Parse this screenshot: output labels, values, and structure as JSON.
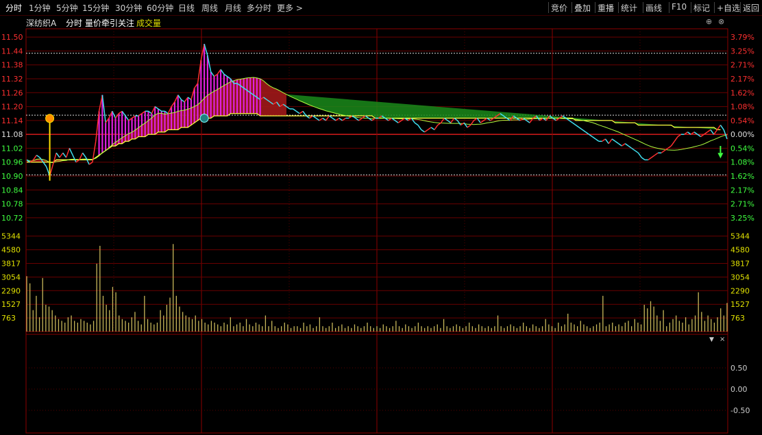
{
  "toolbar": {
    "periods": [
      "分时",
      "1分钟",
      "5分钟",
      "15分钟",
      "30分钟",
      "60分钟",
      "日线",
      "周线",
      "月线",
      "多分时",
      "更多 >"
    ],
    "right": [
      "竞价",
      "叠加",
      "重播",
      "统计",
      "画线",
      "F10",
      "标记",
      "+自选",
      "返回"
    ]
  },
  "header": {
    "stock_name": "深纺织A",
    "mode": "分时",
    "indicator": "量价牵引关注",
    "volume_label": "成交量"
  },
  "colors": {
    "up": "#ff3030",
    "down": "#40ff40",
    "price_line": "#40e0f0",
    "avg_line": "#ffff40",
    "volume": "#c8b85a",
    "grid": "#8b0000",
    "bar": "#e020e0",
    "band": "#a01818",
    "green_band": "#1a8a1a"
  },
  "chart_data": {
    "type": "line",
    "prev_close": 11.08,
    "price_axis": {
      "ticks": [
        "11.50",
        "11.44",
        "11.38",
        "11.32",
        "11.26",
        "11.20",
        "11.14",
        "11.08",
        "11.02",
        "10.96",
        "10.90",
        "10.84",
        "10.78",
        "10.72"
      ],
      "pct_ticks": [
        "3.79%",
        "3.25%",
        "2.71%",
        "2.17%",
        "1.62%",
        "1.08%",
        "0.54%",
        "0.00%",
        "0.54%",
        "1.08%",
        "1.62%",
        "2.17%",
        "2.71%",
        "3.25%"
      ],
      "ylim": [
        10.69,
        11.53
      ]
    },
    "volume_axis": {
      "ticks": [
        "5344",
        "4580",
        "3817",
        "3054",
        "2290",
        "1527",
        "763"
      ],
      "ylim": [
        0,
        5600
      ]
    },
    "indicator_axis": {
      "ticks": [
        "0.50",
        "0.00",
        "-0.50"
      ]
    },
    "price": [
      10.97,
      10.96,
      10.97,
      10.99,
      10.98,
      10.96,
      10.94,
      10.9,
      10.95,
      11.0,
      10.98,
      11.0,
      10.98,
      11.02,
      10.99,
      10.96,
      10.97,
      11.0,
      10.98,
      10.95,
      10.96,
      11.05,
      11.18,
      11.25,
      11.13,
      11.15,
      11.18,
      11.15,
      11.17,
      11.18,
      11.16,
      11.14,
      11.15,
      11.16,
      11.16,
      11.17,
      11.18,
      11.18,
      11.17,
      11.2,
      11.19,
      11.18,
      11.18,
      11.17,
      11.2,
      11.22,
      11.25,
      11.23,
      11.22,
      11.24,
      11.23,
      11.28,
      11.3,
      11.4,
      11.47,
      11.42,
      11.35,
      11.33,
      11.34,
      11.36,
      11.34,
      11.33,
      11.32,
      11.3,
      11.3,
      11.29,
      11.28,
      11.27,
      11.26,
      11.25,
      11.24,
      11.23,
      11.24,
      11.23,
      11.22,
      11.21,
      11.22,
      11.2,
      11.21,
      11.2,
      11.19,
      11.19,
      11.18,
      11.17,
      11.18,
      11.16,
      11.15,
      11.16,
      11.15,
      11.14,
      11.15,
      11.14,
      11.16,
      11.15,
      11.14,
      11.15,
      11.14,
      11.15,
      11.15,
      11.16,
      11.15,
      11.14,
      11.15,
      11.16,
      11.15,
      11.14,
      11.15,
      11.15,
      11.16,
      11.15,
      11.14,
      11.15,
      11.14,
      11.13,
      11.14,
      11.15,
      11.14,
      11.15,
      11.13,
      11.12,
      11.1,
      11.09,
      11.1,
      11.11,
      11.1,
      11.12,
      11.13,
      11.15,
      11.14,
      11.13,
      11.15,
      11.14,
      11.12,
      11.13,
      11.11,
      11.12,
      11.14,
      11.15,
      11.13,
      11.14,
      11.15,
      11.14,
      11.15,
      11.16,
      11.17,
      11.16,
      11.15,
      11.14,
      11.16,
      11.15,
      11.14,
      11.15,
      11.14,
      11.13,
      11.15,
      11.16,
      11.14,
      11.15,
      11.14,
      11.16,
      11.15,
      11.14,
      11.15,
      11.16,
      11.15,
      11.14,
      11.13,
      11.12,
      11.11,
      11.1,
      11.09,
      11.08,
      11.07,
      11.06,
      11.05,
      11.05,
      11.06,
      11.04,
      11.06,
      11.05,
      11.04,
      11.03,
      11.04,
      11.03,
      11.02,
      11.01,
      11.0,
      10.98,
      10.97,
      10.97,
      10.98,
      10.99,
      11.0,
      11.0,
      11.01,
      11.02,
      11.03,
      11.05,
      11.07,
      11.08,
      11.08,
      11.09,
      11.08,
      11.09,
      11.08,
      11.07,
      11.08,
      11.09,
      11.1,
      11.08,
      11.1,
      11.12,
      11.1,
      11.06
    ],
    "avg": [
      10.96,
      10.96,
      10.96,
      10.96,
      10.96,
      10.96,
      10.96,
      10.96,
      10.96,
      10.97,
      10.97,
      10.97,
      10.97,
      10.97,
      10.97,
      10.97,
      10.97,
      10.97,
      10.97,
      10.97,
      10.97,
      10.98,
      10.99,
      11.0,
      11.01,
      11.02,
      11.03,
      11.03,
      11.04,
      11.04,
      11.05,
      11.05,
      11.06,
      11.06,
      11.07,
      11.07,
      11.07,
      11.08,
      11.08,
      11.08,
      11.09,
      11.09,
      11.09,
      11.1,
      11.1,
      11.1,
      11.1,
      11.11,
      11.11,
      11.11,
      11.12,
      11.13,
      11.14,
      11.15,
      11.15,
      11.15,
      11.15,
      11.16,
      11.16,
      11.16,
      11.16,
      11.16,
      11.17,
      11.17,
      11.17,
      11.17,
      11.17,
      11.17,
      11.17,
      11.17,
      11.17,
      11.16,
      11.16,
      11.16,
      11.16,
      11.16,
      11.16,
      11.16,
      11.16,
      11.16,
      11.16,
      11.16,
      11.16,
      11.16,
      11.16,
      11.16,
      11.16,
      11.16,
      11.16,
      11.16,
      11.16,
      11.16,
      11.16,
      11.16,
      11.16,
      11.16,
      11.16,
      11.16,
      11.16,
      11.16,
      11.16,
      11.16,
      11.16,
      11.16,
      11.16,
      11.16,
      11.15,
      11.15,
      11.15,
      11.15,
      11.15,
      11.15,
      11.15,
      11.15,
      11.15,
      11.15,
      11.15,
      11.15,
      11.15,
      11.15,
      11.15,
      11.15,
      11.15,
      11.15,
      11.15,
      11.15,
      11.15,
      11.15,
      11.15,
      11.15,
      11.15,
      11.15,
      11.15,
      11.15,
      11.15,
      11.15,
      11.15,
      11.15,
      11.15,
      11.15,
      11.15,
      11.15,
      11.15,
      11.15,
      11.15,
      11.15,
      11.15,
      11.15,
      11.15,
      11.15,
      11.15,
      11.15,
      11.15,
      11.15,
      11.15,
      11.15,
      11.15,
      11.15,
      11.15,
      11.15,
      11.15,
      11.15,
      11.15,
      11.15,
      11.15,
      11.15,
      11.15,
      11.14,
      11.14,
      11.14,
      11.14,
      11.14,
      11.14,
      11.14,
      11.14,
      11.14,
      11.14,
      11.14,
      11.14,
      11.13,
      11.13,
      11.13,
      11.13,
      11.13,
      11.13,
      11.13,
      11.12,
      11.12,
      11.12,
      11.12,
      11.12,
      11.12,
      11.12,
      11.12,
      11.12,
      11.12,
      11.12,
      11.11,
      11.11,
      11.11,
      11.11,
      11.11,
      11.11,
      11.11,
      11.11,
      11.11,
      11.11,
      11.11,
      11.11,
      11.11,
      11.1,
      11.1
    ],
    "volume": [
      3100,
      2700,
      1200,
      2000,
      800,
      3000,
      1500,
      1400,
      1200,
      900,
      700,
      600,
      500,
      800,
      900,
      600,
      500,
      700,
      600,
      500,
      400,
      600,
      3800,
      4800,
      2000,
      1500,
      1200,
      2500,
      2200,
      900,
      700,
      600,
      500,
      800,
      1100,
      600,
      400,
      2000,
      700,
      500,
      400,
      500,
      1200,
      900,
      1500,
      1900,
      4900,
      2000,
      1400,
      1100,
      900,
      800,
      700,
      900,
      600,
      700,
      500,
      400,
      600,
      500,
      400,
      300,
      500,
      400,
      800,
      300,
      400,
      500,
      300,
      700,
      400,
      300,
      500,
      400,
      300,
      900,
      300,
      600,
      300,
      200,
      300,
      500,
      400,
      200,
      300,
      300,
      200,
      500,
      300,
      400,
      200,
      300,
      800,
      300,
      200,
      300,
      500,
      200,
      300,
      400,
      200,
      300,
      200,
      400,
      300,
      200,
      300,
      500,
      300,
      200,
      300,
      200,
      400,
      300,
      200,
      300,
      600,
      300,
      200,
      400,
      300,
      200,
      300,
      500,
      300,
      200,
      300,
      200,
      300,
      400,
      200,
      700,
      300,
      200,
      300,
      400,
      300,
      200,
      300,
      500,
      300,
      200,
      400,
      300,
      200,
      300,
      200,
      300,
      900,
      300,
      200,
      300,
      400,
      300,
      200,
      300,
      500,
      300,
      200,
      400,
      300,
      200,
      300,
      700,
      400,
      300,
      200,
      500,
      300,
      400,
      1000,
      500,
      400,
      300,
      600,
      400,
      300,
      200,
      300,
      400,
      500,
      2000,
      300,
      400,
      500,
      300,
      400,
      300,
      500,
      600,
      300,
      700,
      500,
      400,
      1500,
      1300,
      1700,
      1400,
      900,
      600,
      1200,
      300,
      500,
      700,
      900,
      600,
      500,
      800,
      400,
      700,
      900,
      2200,
      1100,
      600,
      900,
      700,
      500,
      800,
      1300,
      900,
      1600
    ]
  }
}
